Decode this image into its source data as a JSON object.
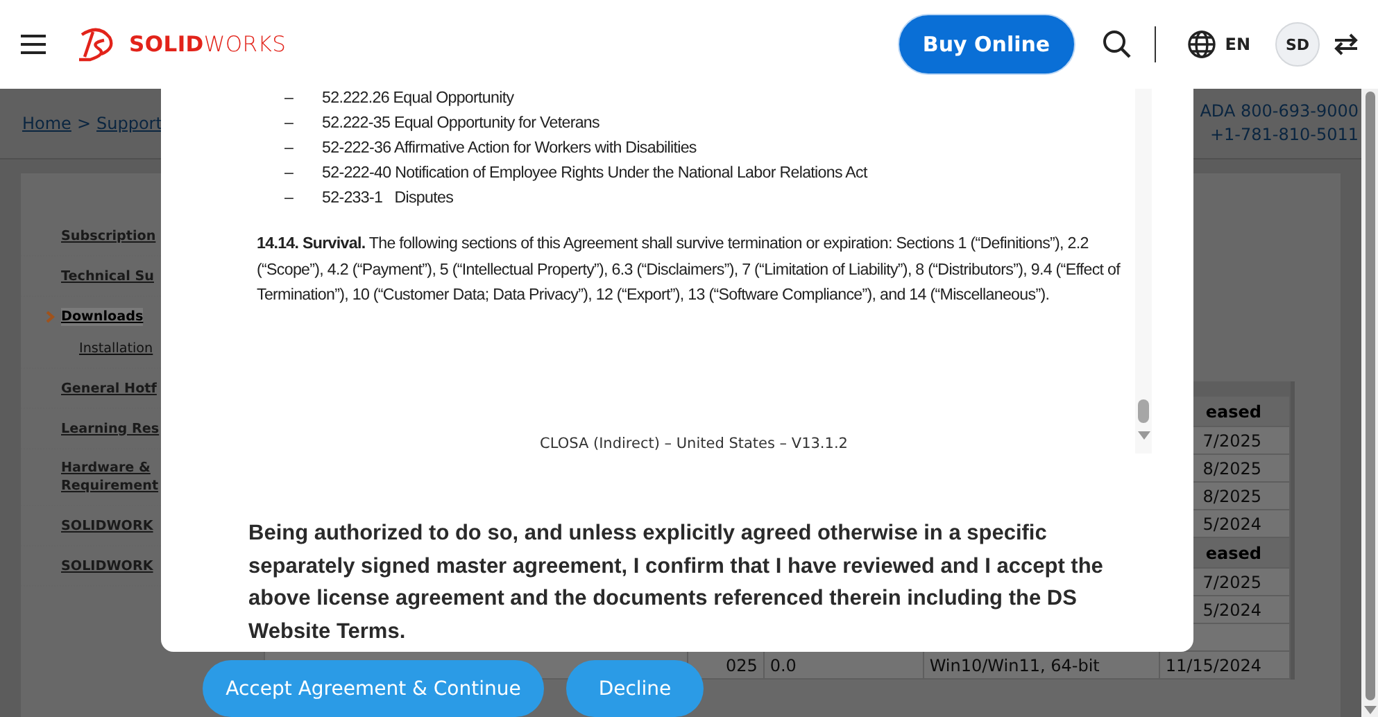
{
  "header": {
    "brand": "**SOLID**WORKS",
    "buy_button": "Buy Online",
    "language": "EN",
    "avatar": "SD"
  },
  "page": {
    "breadcrumb": [
      "Home",
      ">",
      "Support"
    ],
    "contact": [
      "ADA 800-693-9000",
      "+1-781-810-5011"
    ],
    "sidebar": {
      "items": [
        {
          "label": "Subscription",
          "kind": "main",
          "selected": false
        },
        {
          "label": "Technical Su",
          "kind": "main",
          "selected": false
        },
        {
          "label": "Downloads",
          "kind": "main",
          "selected": true
        },
        {
          "label": "Installation",
          "kind": "sub",
          "selected": false
        },
        {
          "label": "General Hotf",
          "kind": "main",
          "selected": false
        },
        {
          "label": "Learning Res",
          "kind": "main",
          "selected": false
        },
        {
          "label": "Hardware &\nRequirement",
          "kind": "main",
          "selected": false
        },
        {
          "label": "SOLIDWORK",
          "kind": "main",
          "selected": false
        },
        {
          "label": "SOLIDWORK",
          "kind": "main",
          "selected": false
        }
      ]
    },
    "table": {
      "rows": [
        {
          "kind": "header",
          "column_5": "eased"
        },
        {
          "kind": "data",
          "column_5": "7/2025"
        },
        {
          "kind": "data",
          "column_5": "8/2025"
        },
        {
          "kind": "data",
          "column_5": "8/2025"
        },
        {
          "kind": "data",
          "column_5": "5/2024"
        },
        {
          "kind": "header",
          "column_5": "eased"
        },
        {
          "kind": "data",
          "column_5": "7/2025"
        },
        {
          "kind": "data",
          "column_5": "5/2024"
        },
        {
          "kind": "data"
        },
        {
          "kind": "data",
          "column_2": "025",
          "column_3": "0.0",
          "column_4": "Win10/Win11, 64-bit",
          "column_5": "11/15/2024"
        }
      ]
    }
  },
  "dialog": {
    "clauses": [
      {
        "mark": "–",
        "text": "52.222.26 Equal Opportunity"
      },
      {
        "mark": "–",
        "text": "52.222-35 Equal Opportunity for Veterans"
      },
      {
        "mark": "–",
        "text": "52-222-36 Affirmative Action for Workers with Disabilities"
      },
      {
        "mark": "–",
        "text": "52-222-40 Notification of Employee Rights Under the National Labor Relations Act"
      },
      {
        "mark": "–",
        "text": "52-233-1   Disputes"
      }
    ],
    "survival": "**14.14.  Survival.** The following sections of this Agreement shall survive termination or expiration:  Sections 1 (“Definitions”), 2.2 (“Scope”), 4.2 (“Payment”), 5 (“Intellectual Property”), 6.3 (“Disclaimers”), 7 (“Limitation of Liability”), 8 (“Distributors”), 9.4 (“Effect of Termination”), 10 (“Customer Data; Data Privacy”), 12 (“Export”), 13 (“Software Compliance”), and 14 (“Miscellaneous”).",
    "footer": "CLOSA (Indirect) – United States – V13.1.2",
    "confirmation": "Being authorized to do so, and unless explicitly agreed otherwise in a specific separately signed master agreement, I confirm that I have reviewed and I accept the above license agreement and the documents referenced therein including the DS Website Terms.",
    "buttons": [
      "Accept Agreement & Continue",
      "Decline"
    ]
  }
}
